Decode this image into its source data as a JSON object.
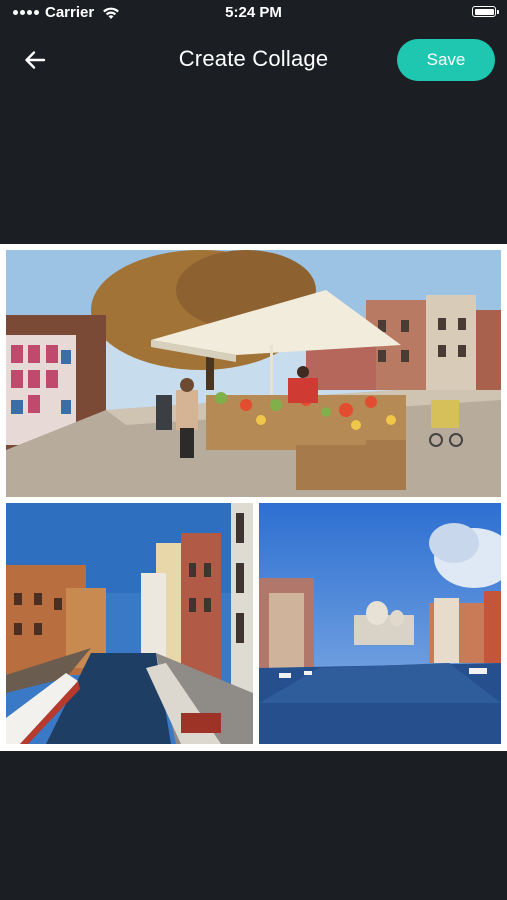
{
  "status_bar": {
    "carrier": "Carrier",
    "time": "5:24 PM"
  },
  "nav": {
    "title": "Create Collage",
    "save_label": "Save",
    "back_icon": "arrow-left-icon"
  },
  "colors": {
    "background": "#1b1f24",
    "accent": "#1fc7b0",
    "collage_border": "#ffffff"
  },
  "collage": {
    "layout": "1-top-2-bottom",
    "photos": [
      {
        "slot": "top",
        "subject": "market-stall-photo"
      },
      {
        "slot": "bottom-left",
        "subject": "canal-street-photo"
      },
      {
        "slot": "bottom-right",
        "subject": "grand-canal-photo"
      }
    ]
  }
}
